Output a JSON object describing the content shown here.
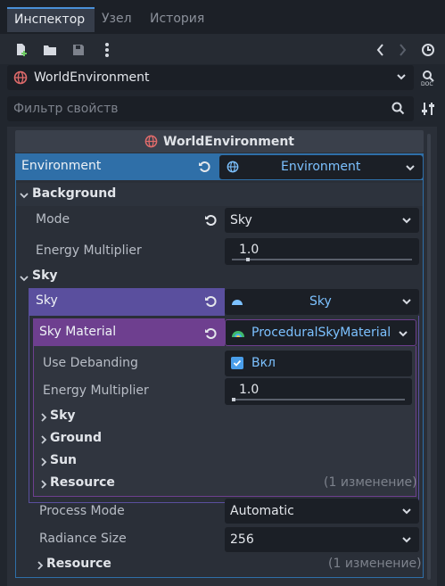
{
  "tabs": [
    {
      "label": "Инспектор"
    },
    {
      "label": "Узел"
    },
    {
      "label": "История"
    }
  ],
  "object_selector": {
    "name": "WorldEnvironment"
  },
  "filter": {
    "placeholder": "Фильтр свойств"
  },
  "header": {
    "title": "WorldEnvironment"
  },
  "environment": {
    "label": "Environment",
    "value": "Environment"
  },
  "background": {
    "section": "Background",
    "mode_label": "Mode",
    "mode_value": "Sky",
    "energy_label": "Energy Multiplier",
    "energy_value": "1.0",
    "energy_fraction": 0.08
  },
  "sky_section": {
    "label": "Sky"
  },
  "sky": {
    "label": "Sky",
    "value": "Sky"
  },
  "sky_material": {
    "label": "Sky Material",
    "value": "ProceduralSkyMaterial",
    "debanding_label": "Use Debanding",
    "debanding_value": "Вкл",
    "debanding_checked": true,
    "energy_label": "Energy Multiplier",
    "energy_value": "1.0",
    "energy_fraction": 0.0,
    "groups": [
      {
        "label": "Sky"
      },
      {
        "label": "Ground"
      },
      {
        "label": "Sun"
      },
      {
        "label": "Resource",
        "note": "(1 изменение)"
      }
    ]
  },
  "process": {
    "label": "Process Mode",
    "value": "Automatic"
  },
  "radiance": {
    "label": "Radiance Size",
    "value": "256"
  },
  "resource": {
    "label": "Resource",
    "note": "(1 изменение)"
  },
  "colors": {
    "accent": "#4a90d9",
    "env_blue": "#2f6fa8",
    "sky_purple": "#5a4f9e",
    "material_violet": "#6e3f8f"
  }
}
